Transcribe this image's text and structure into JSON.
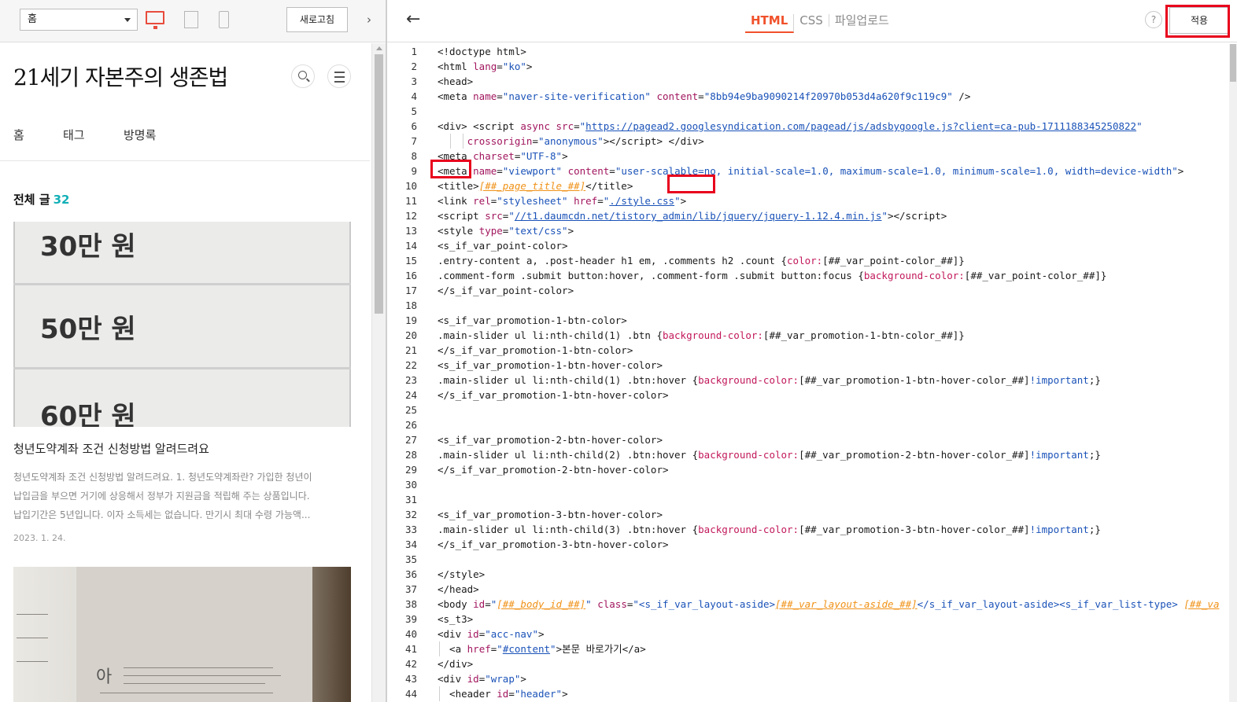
{
  "preview": {
    "toolbar": {
      "select_value": "홈",
      "devices": [
        "desktop-icon",
        "tablet-icon",
        "mobile-icon"
      ],
      "refresh_label": "새로고침",
      "collapse_glyph": "›"
    },
    "blog_title": "21세기 자본주의 생존법",
    "nav": [
      "홈",
      "태그",
      "방명록"
    ],
    "total_label": "전체 글",
    "total_count": "32",
    "thumbnail_text": [
      "30만 원",
      "50만 원",
      "60만 원"
    ],
    "post": {
      "title": "청년도약계좌 조건 신청방법 알려드려요",
      "summary_lines": [
        "청년도약계좌 조건 신청방법 알려드려요. 1. 청년도약계좌란? 가입한 청년이",
        "납입금을 부으면 거기에 상응해서 정부가 지원금을 적립해 주는 상품입니다.",
        "납입기간은 5년입니다. 이자 소득세는 없습니다. 만기시 최대 수령 가능액..."
      ],
      "date": "2023. 1. 24."
    },
    "thumbnail2_char": "아"
  },
  "editor": {
    "back_icon": "←",
    "tabs": [
      "HTML",
      "CSS",
      "파일업로드"
    ],
    "active_tab": "HTML",
    "help_label": "?",
    "apply_label": "적용",
    "highlight_color": "#e8001c",
    "accent_color": "#f0512b"
  }
}
